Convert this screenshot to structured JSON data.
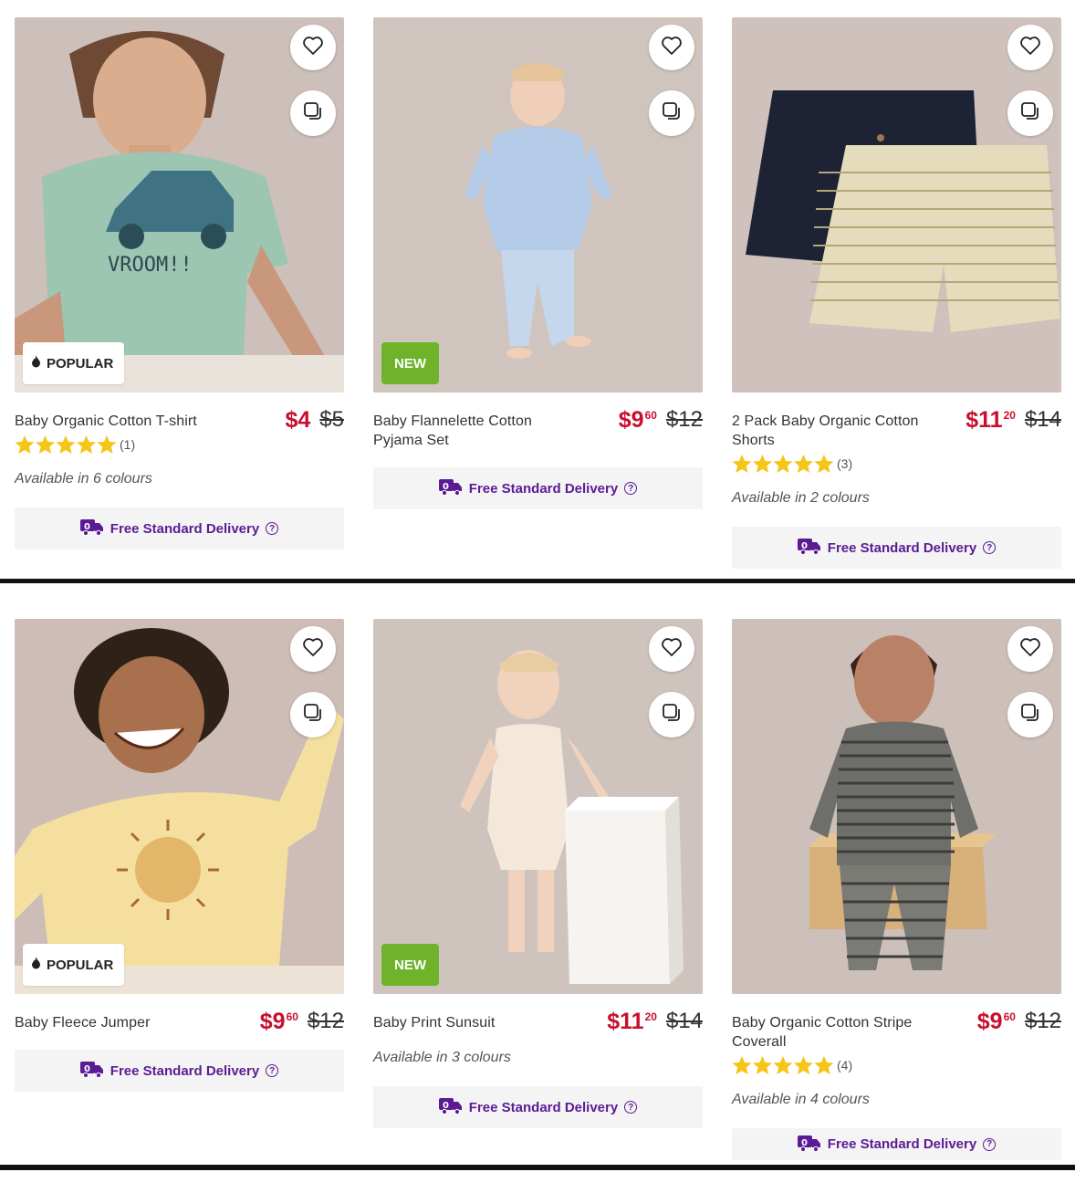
{
  "delivery_label": "Free Standard Delivery",
  "badges": {
    "popular": "POPULAR",
    "new": "NEW"
  },
  "products": [
    {
      "name": "Baby Organic Cotton T-shirt",
      "price_main": "$4",
      "price_cents": "",
      "was": "$5",
      "rating": 5,
      "reviews": "(1)",
      "availability": "Available in 6 colours",
      "badge": "POPULAR"
    },
    {
      "name": "Baby Flannelette Cotton Pyjama Set",
      "price_main": "$9",
      "price_cents": "60",
      "was": "$12",
      "badge": "NEW"
    },
    {
      "name": "2 Pack Baby Organic Cotton Shorts",
      "price_main": "$11",
      "price_cents": "20",
      "was": "$14",
      "rating": 4.5,
      "reviews": "(3)",
      "availability": "Available in 2 colours"
    },
    {
      "name": "Baby Fleece Jumper",
      "price_main": "$9",
      "price_cents": "60",
      "was": "$12",
      "badge": "POPULAR"
    },
    {
      "name": "Baby Print Sunsuit",
      "price_main": "$11",
      "price_cents": "20",
      "was": "$14",
      "availability": "Available in 3 colours",
      "badge": "NEW"
    },
    {
      "name": "Baby Organic Cotton Stripe Coverall",
      "price_main": "$9",
      "price_cents": "60",
      "was": "$12",
      "rating": 4.5,
      "reviews": "(4)",
      "availability": "Available in 4 colours"
    }
  ],
  "colors": {
    "price": "#c8102e",
    "delivery": "#5b1b94",
    "new_badge": "#6fb32a",
    "star": "#f5c518",
    "photo_bg": "#cdbfb9"
  },
  "icons": {
    "favourite": "heart-icon",
    "compare": "compare-icon",
    "popular": "flame-icon",
    "delivery": "delivery-truck-icon",
    "help": "help-icon"
  }
}
